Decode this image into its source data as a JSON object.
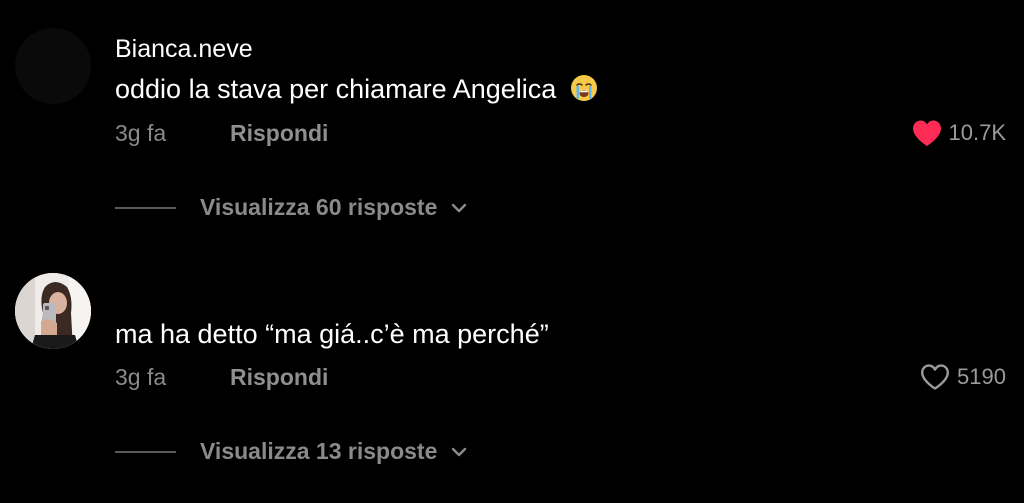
{
  "comments": [
    {
      "username": "Bianca.neve",
      "text": "oddio la stava per chiamare Angelica",
      "emoji_icon": "loudly-crying-face-emoji",
      "time": "3g fa",
      "reply_label": "Rispondi",
      "likes": "10.7K",
      "liked": true,
      "view_replies": "Visualizza 60 risposte"
    },
    {
      "username": "",
      "text": "ma ha detto “ma giá..c’è ma perché”",
      "time": "3g fa",
      "reply_label": "Rispondi",
      "likes": "5190",
      "liked": false,
      "view_replies": "Visualizza 13 risposte"
    }
  ],
  "colors": {
    "background": "#000000",
    "liked_heart": "#fe2c55",
    "muted_text": "#8a8a8a"
  }
}
